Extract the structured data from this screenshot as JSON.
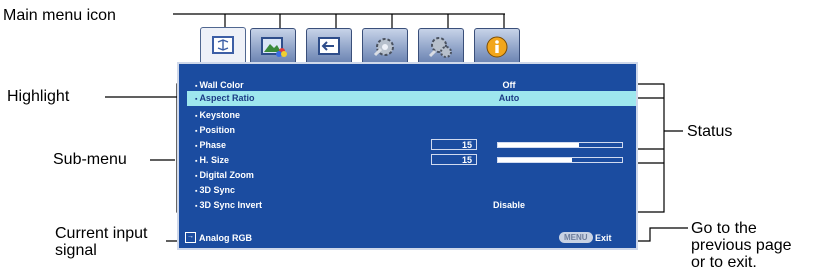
{
  "annotations": {
    "main_menu_icon": "Main menu icon",
    "highlight": "Highlight",
    "sub_menu": "Sub-menu",
    "current_input_line1": "Current input",
    "current_input_line2": "signal",
    "status": "Status",
    "go_back_line1": "Go to the",
    "go_back_line2": "previous page",
    "go_back_line3": "or to exit."
  },
  "tabs": [
    {
      "icon": "display-icon"
    },
    {
      "icon": "picture-icon"
    },
    {
      "icon": "source-icon"
    },
    {
      "icon": "system-setup-basic-icon"
    },
    {
      "icon": "system-setup-advanced-icon"
    },
    {
      "icon": "information-icon"
    }
  ],
  "menu": {
    "items": [
      {
        "label": "Wall Color",
        "value": "Off"
      },
      {
        "label": "Aspect Ratio",
        "value": "Auto",
        "highlighted": true
      },
      {
        "label": "Keystone",
        "value": ""
      },
      {
        "label": "Position",
        "value": ""
      },
      {
        "label": "Phase",
        "number": "15",
        "level": 0.65
      },
      {
        "label": "H. Size",
        "number": "15",
        "level": 0.6
      },
      {
        "label": "Digital Zoom",
        "value": ""
      },
      {
        "label": "3D Sync",
        "value": ""
      },
      {
        "label": "3D Sync Invert",
        "value": "Disable"
      }
    ],
    "input_signal": "Analog RGB",
    "menu_button": "MENU",
    "exit_label": "Exit"
  },
  "colors": {
    "panel": "#1b4ca0",
    "highlight": "#9ee7ee",
    "tab_active": "#eef1f8"
  }
}
